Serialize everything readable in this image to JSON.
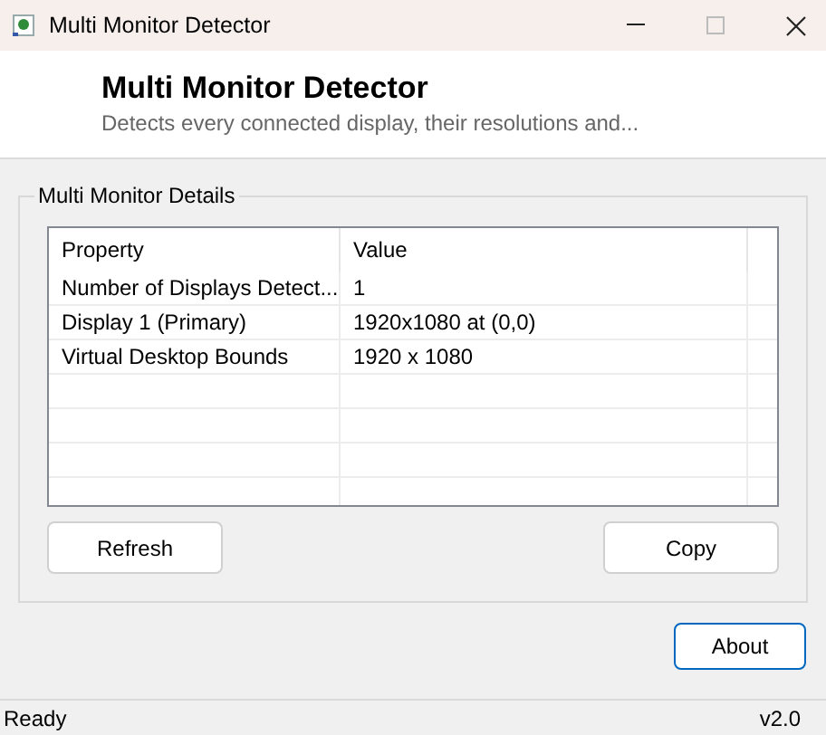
{
  "window": {
    "title": "Multi Monitor Detector"
  },
  "header": {
    "title": "Multi Monitor Detector",
    "subtitle": "Detects every connected display, their resolutions and..."
  },
  "group": {
    "title": "Multi Monitor Details",
    "table": {
      "columns": [
        "Property",
        "Value"
      ],
      "rows": [
        [
          "Number of Displays Detect...",
          "1"
        ],
        [
          "Display 1 (Primary)",
          "1920x1080 at (0,0)"
        ],
        [
          "Virtual Desktop Bounds",
          "1920 x 1080"
        ]
      ]
    },
    "buttons": [
      {
        "label": "Refresh"
      },
      {
        "label": "Copy"
      }
    ]
  },
  "about_button": {
    "label": "About",
    "focused": true
  },
  "status_bar": {
    "text": "Ready",
    "version": "v2.0"
  }
}
